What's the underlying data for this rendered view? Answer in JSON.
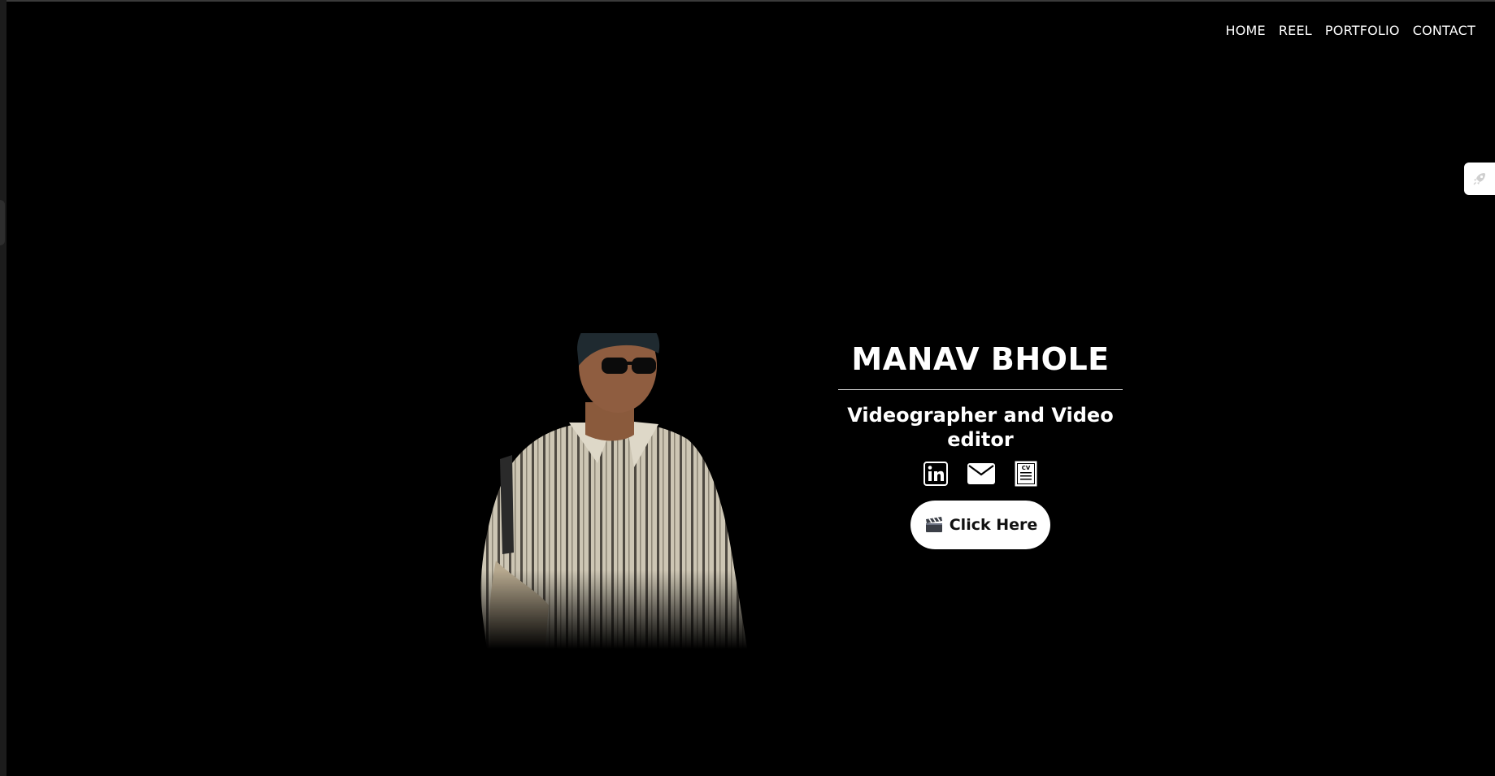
{
  "nav": {
    "items": [
      {
        "label": "HOME"
      },
      {
        "label": "REEL"
      },
      {
        "label": "PORTFOLIO"
      },
      {
        "label": "CONTACT"
      }
    ]
  },
  "hero": {
    "name": "MANAV BHOLE",
    "role": "Videographer and Video editor",
    "cta_label": "Click Here",
    "cta_icon": "clapperboard-icon"
  },
  "social": {
    "linkedin_icon": "linkedin-icon",
    "email_icon": "envelope-icon",
    "cv_icon": "cv-document-icon",
    "cv_text": "CV"
  },
  "side_widget": {
    "icon": "rocket-icon"
  },
  "colors": {
    "background": "#000000",
    "text": "#ffffff",
    "button_bg": "#ffffff",
    "button_text": "#111111"
  }
}
